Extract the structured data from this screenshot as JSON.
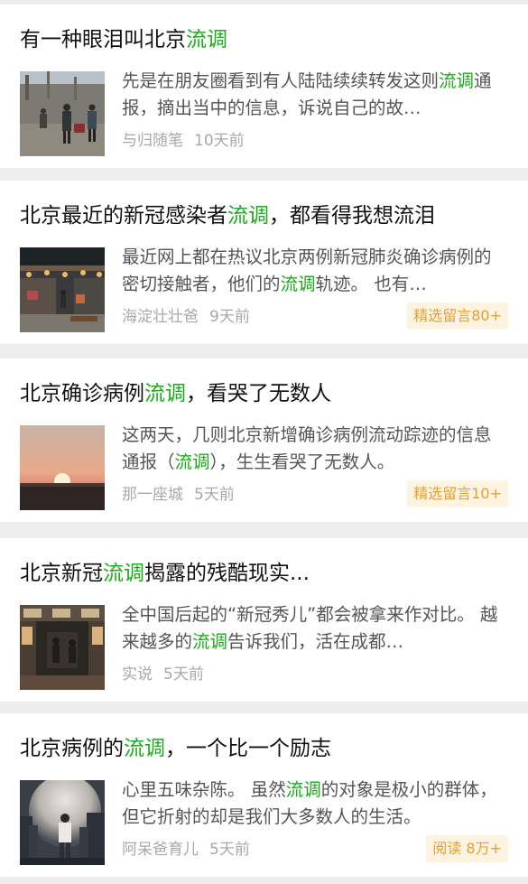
{
  "articles": [
    {
      "title_pre": "有一种眼泪叫北京",
      "title_hl": "流调",
      "title_post": "",
      "ex_pre": "先是在朋友圈看到有人陆陆续续转发这则",
      "ex_hl": "流调",
      "ex_post": "通报，摘出当中的信息，诉说自己的故…",
      "author": "与归随笔",
      "time": "10天前",
      "badge": ""
    },
    {
      "title_pre": "北京最近的新冠感染者",
      "title_hl": "流调",
      "title_post": "，都看得我想流泪",
      "ex_pre": "最近网上都在热议北京两例新冠肺炎确诊病例的密切接触者，他们的",
      "ex_hl": "流调",
      "ex_post": "轨迹。 也有…",
      "author": "海淀壮壮爸",
      "time": "9天前",
      "badge": "精选留言80+"
    },
    {
      "title_pre": "北京确诊病例",
      "title_hl": "流调",
      "title_post": "，看哭了无数人",
      "ex_pre": "这两天，几则北京新增确诊病例流动踪迹的信息通报（",
      "ex_hl": "流调",
      "ex_post": "），生生看哭了无数人。",
      "author": "那一座城",
      "time": "5天前",
      "badge": "精选留言10+"
    },
    {
      "title_pre": "北京新冠",
      "title_hl": "流调",
      "title_post": "揭露的残酷现实...",
      "ex_pre": "全中国后起的“新冠秀儿”都会被拿来作对比。 越来越多的",
      "ex_hl": "流调",
      "ex_post": "告诉我们，活在成都…",
      "author": "实说",
      "time": "5天前",
      "badge": ""
    },
    {
      "title_pre": "北京病例的",
      "title_hl": "流调",
      "title_post": "，一个比一个励志",
      "ex_pre": "心里五味杂陈。 虽然",
      "ex_hl": "流调",
      "ex_post": "的对象是极小的群体，但它折射的却是我们大多数人的生活。",
      "author": "阿呆爸育儿",
      "time": "5天前",
      "badge": "阅读 8万+"
    }
  ],
  "colors": {
    "accent": "#1aad19",
    "badge_text": "#e4a032",
    "badge_bg": "#fdf3e1"
  }
}
